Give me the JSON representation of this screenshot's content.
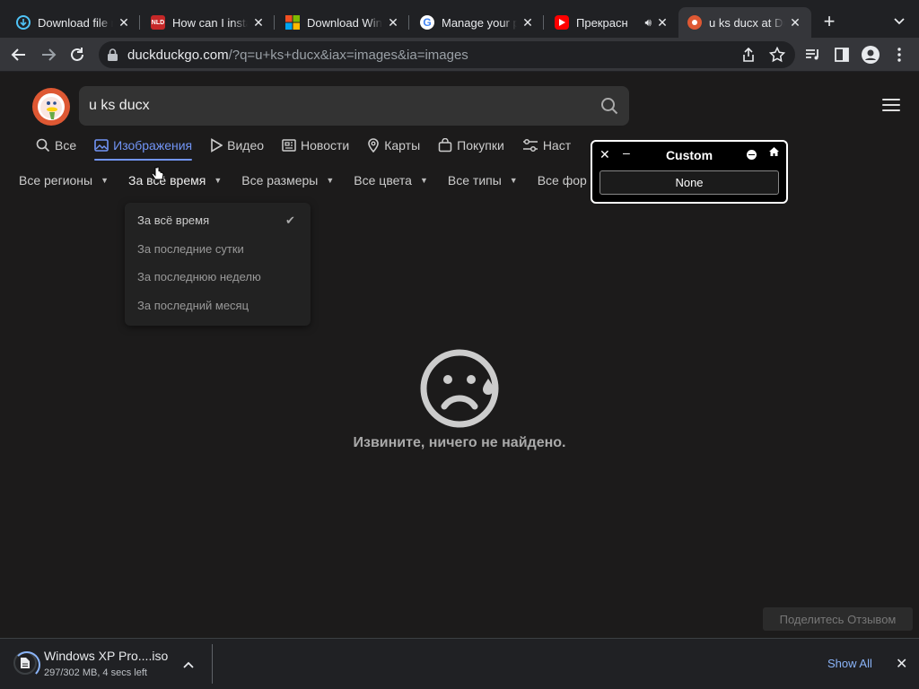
{
  "tabs": [
    {
      "title": "Download file r",
      "icon": "cloud-download-icon"
    },
    {
      "title": "How can I insta",
      "icon": "nld-site-icon"
    },
    {
      "title": "Download Wind",
      "icon": "microsoft-icon"
    },
    {
      "title": "Manage your p",
      "icon": "google-icon"
    },
    {
      "title": "Прекрасн",
      "icon": "youtube-icon"
    },
    {
      "title": "u ks ducx at Du",
      "icon": "duckduckgo-icon",
      "active": true
    }
  ],
  "omnibox": {
    "host": "duckduckgo.com",
    "path": "/?q=u+ks+ducx&iax=images&ia=images"
  },
  "search": {
    "query": "u ks ducx"
  },
  "navtabs": [
    {
      "label": "Все"
    },
    {
      "label": "Изображения",
      "active": true
    },
    {
      "label": "Видео"
    },
    {
      "label": "Новости"
    },
    {
      "label": "Карты"
    },
    {
      "label": "Покупки"
    },
    {
      "label": "Наст"
    }
  ],
  "filters": [
    {
      "label": "Все регионы"
    },
    {
      "label": "За всё время"
    },
    {
      "label": "Все размеры"
    },
    {
      "label": "Все цвета"
    },
    {
      "label": "Все типы"
    },
    {
      "label": "Все фор"
    }
  ],
  "time_dropdown": {
    "options": [
      "За всё время",
      "За последние сутки",
      "За последнюю неделю",
      "За последний месяц"
    ],
    "selected": "За всё время"
  },
  "no_results": "Извините, ничего не найдено.",
  "feedback": "Поделитесь Отзывом",
  "custom_panel": {
    "title": "Custom",
    "button": "None"
  },
  "download": {
    "name": "Windows XP Pro....iso",
    "status": "297/302 MB, 4 secs left",
    "progress_fraction": 0.98,
    "show_all": "Show All"
  },
  "colors": {
    "accent": "#7295f6",
    "ddg_orange": "#de5833",
    "chrome_link": "#8ab4f8"
  }
}
